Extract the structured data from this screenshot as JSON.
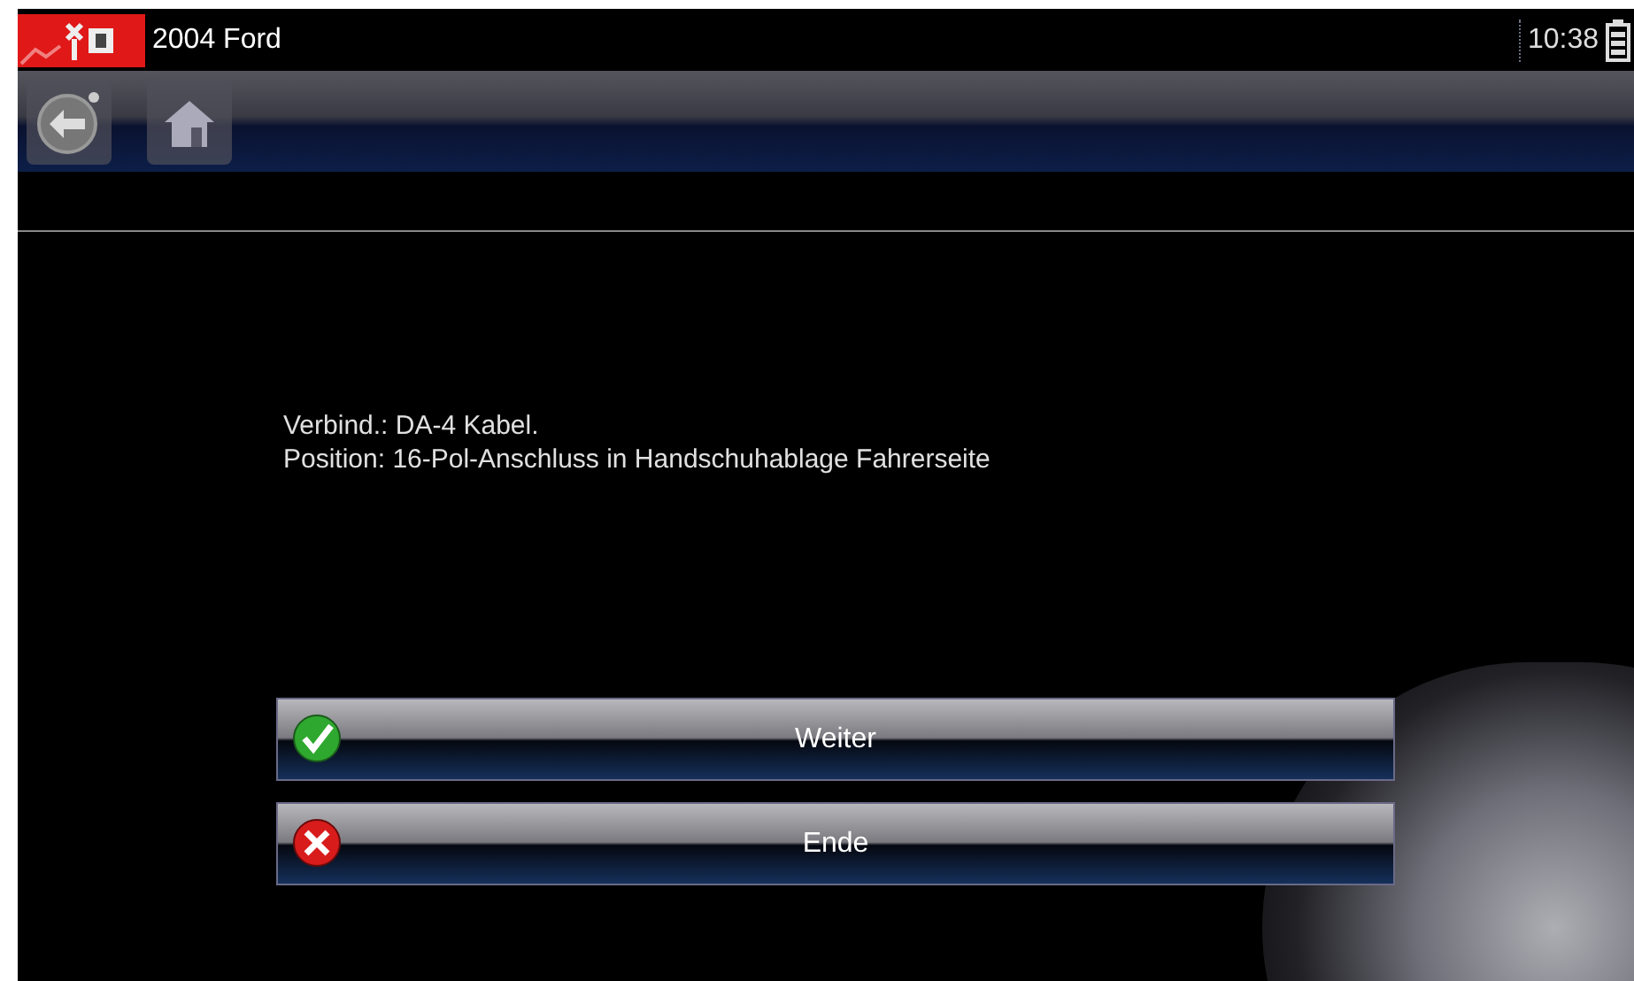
{
  "header": {
    "title": "2004 Ford",
    "time": "10:38"
  },
  "message": [
    "Verbind.: DA-4 Kabel.",
    "Position: 16-Pol-Anschluss in Handschuhablage Fahrerseite"
  ],
  "buttons": [
    {
      "label": "Weiter",
      "kind": "confirm"
    },
    {
      "label": "Ende",
      "kind": "cancel"
    }
  ]
}
